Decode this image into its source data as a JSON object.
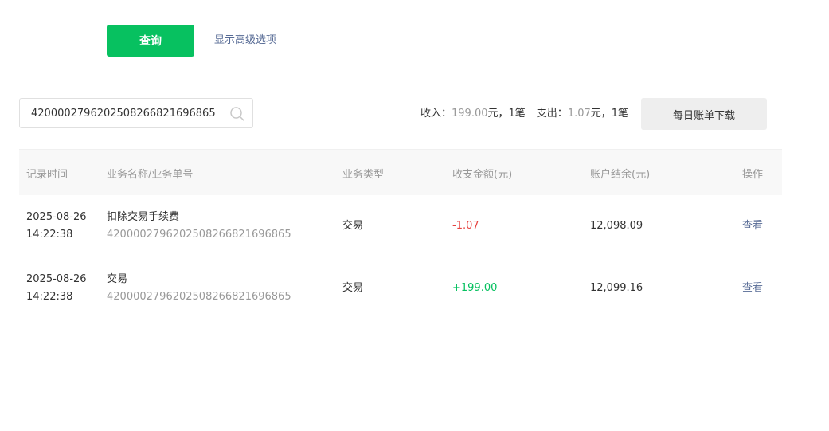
{
  "toolbar": {
    "query_label": "查询",
    "advanced_label": "显示高级选项"
  },
  "search": {
    "value": "4200002796202508266821696865",
    "placeholder": ""
  },
  "summary": {
    "income_label": "收入：",
    "income_amount": "199.00",
    "income_suffix": "元，1笔",
    "expense_label": "支出：",
    "expense_amount": "1.07",
    "expense_suffix": "元，1笔",
    "download_label": "每日账单下载"
  },
  "table": {
    "headers": [
      "记录时间",
      "业务名称/业务单号",
      "业务类型",
      "收支金额(元)",
      "账户结余(元)",
      "操作"
    ],
    "rows": [
      {
        "date": "2025-08-26",
        "time": "14:22:38",
        "name": "扣除交易手续费",
        "order_no": "4200002796202508266821696865",
        "type": "交易",
        "amount": "-1.07",
        "balance": "12,098.09",
        "action": "查看"
      },
      {
        "date": "2025-08-26",
        "time": "14:22:38",
        "name": "交易",
        "order_no": "4200002796202508266821696865",
        "type": "交易",
        "amount": "+199.00",
        "balance": "12,099.16",
        "action": "查看"
      }
    ]
  },
  "colors": {
    "primary": "#07c160",
    "link": "#576b95",
    "negative": "#e64340",
    "positive": "#07c160"
  }
}
